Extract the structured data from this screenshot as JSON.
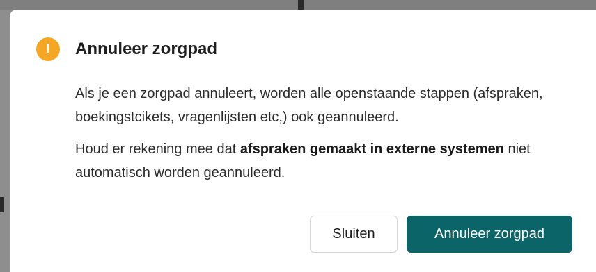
{
  "dialog": {
    "title": "Annuleer zorgpad",
    "icon": "warning-icon",
    "icon_glyph": "!",
    "paragraph1": "Als je een zorgpad annuleert, worden alle openstaande stappen (afspraken, boekingstcikets, vragenlijsten etc,) ook geannuleerd.",
    "paragraph2_prefix": "Houd er rekening mee dat ",
    "paragraph2_bold": "afspraken gemaakt in externe systemen",
    "paragraph2_suffix": " niet automatisch worden geannuleerd.",
    "close_label": "Sluiten",
    "confirm_label": "Annuleer zorgpad"
  },
  "colors": {
    "accent": "#0b6467",
    "warning": "#f5a623"
  }
}
